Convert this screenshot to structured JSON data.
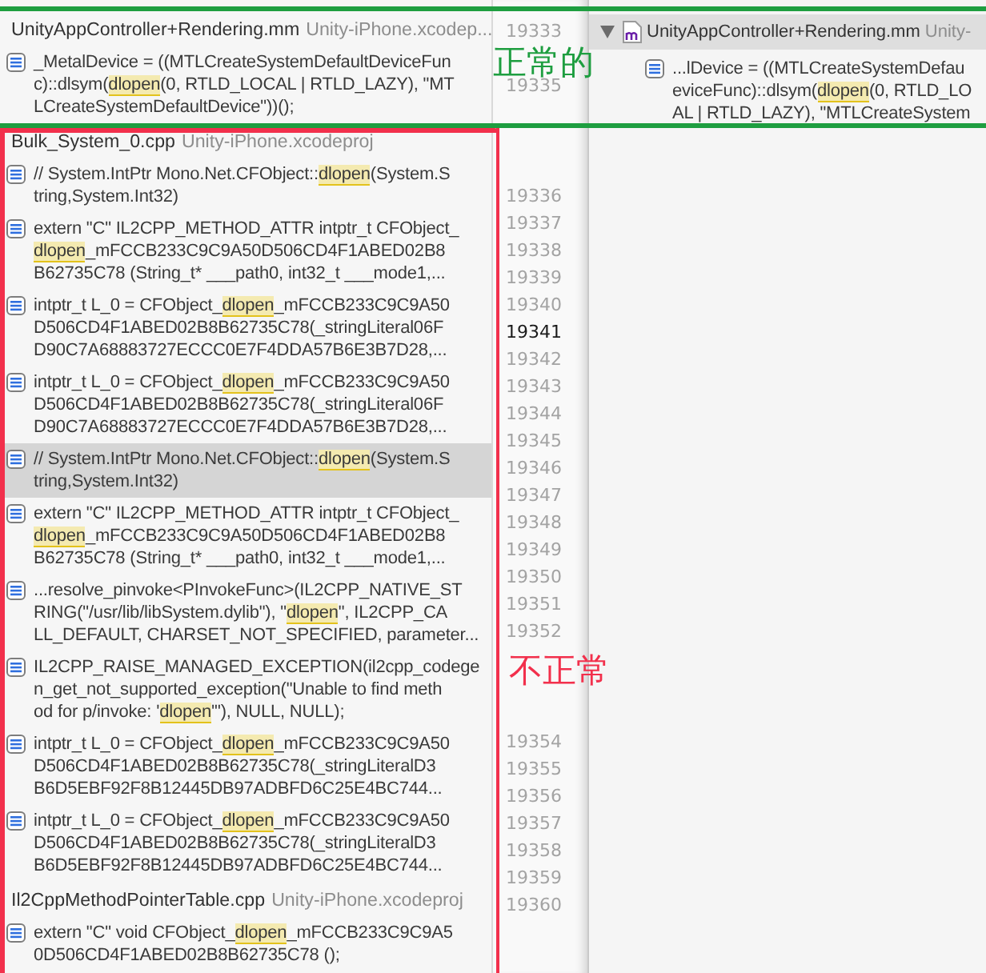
{
  "results_panel": {
    "groups": [
      {
        "file": "UnityAppController+Rendering.mm",
        "project": "Unity-iPhone.xcodep...",
        "results": [
          {
            "selected": false,
            "lines": [
              {
                "pre": "_MetalDevice = ((MTLCreateSystemDefaultDeviceFun"
              },
              {
                "pre": "c)::dlsym(",
                "hit": "dlopen",
                "post": "(0, RTLD_LOCAL | RTLD_LAZY), \"MT"
              },
              {
                "pre": "LCreateSystemDefaultDevice\"))();"
              }
            ]
          }
        ]
      },
      {
        "file": "Bulk_System_0.cpp",
        "project": "Unity-iPhone.xcodeproj",
        "results": [
          {
            "selected": false,
            "lines": [
              {
                "pre": "// System.IntPtr Mono.Net.CFObject::",
                "hit": "dlopen",
                "post": "(System.S"
              },
              {
                "pre": "tring,System.Int32)"
              }
            ]
          },
          {
            "selected": false,
            "lines": [
              {
                "pre": "extern \"C\" IL2CPP_METHOD_ATTR intptr_t CFObject_"
              },
              {
                "hit": "dlopen",
                "post": "_mFCCB233C9C9A50D506CD4F1ABED02B8"
              },
              {
                "pre": "B62735C78 (String_t* ___path0, int32_t ___mode1,..."
              }
            ]
          },
          {
            "selected": false,
            "lines": [
              {
                "pre": "intptr_t L_0 = CFObject_",
                "hit": "dlopen",
                "post": "_mFCCB233C9C9A50"
              },
              {
                "pre": "D506CD4F1ABED02B8B62735C78(_stringLiteral06F"
              },
              {
                "pre": "D90C7A68883727ECCC0E7F4DDA57B6E3B7D28,..."
              }
            ]
          },
          {
            "selected": false,
            "lines": [
              {
                "pre": "intptr_t L_0 = CFObject_",
                "hit": "dlopen",
                "post": "_mFCCB233C9C9A50"
              },
              {
                "pre": "D506CD4F1ABED02B8B62735C78(_stringLiteral06F"
              },
              {
                "pre": "D90C7A68883727ECCC0E7F4DDA57B6E3B7D28,..."
              }
            ]
          },
          {
            "selected": true,
            "lines": [
              {
                "pre": "// System.IntPtr Mono.Net.CFObject::",
                "hit": "dlopen",
                "post": "(System.S"
              },
              {
                "pre": "tring,System.Int32)"
              }
            ]
          },
          {
            "selected": false,
            "lines": [
              {
                "pre": "extern \"C\" IL2CPP_METHOD_ATTR intptr_t CFObject_"
              },
              {
                "hit": "dlopen",
                "post": "_mFCCB233C9C9A50D506CD4F1ABED02B8"
              },
              {
                "pre": "B62735C78 (String_t* ___path0, int32_t ___mode1,..."
              }
            ]
          },
          {
            "selected": false,
            "lines": [
              {
                "pre": "...resolve_pinvoke<PInvokeFunc>(IL2CPP_NATIVE_ST"
              },
              {
                "pre": "RING(\"/usr/lib/libSystem.dylib\"), \"",
                "hit": "dlopen",
                "post": "\", IL2CPP_CA"
              },
              {
                "pre": "LL_DEFAULT, CHARSET_NOT_SPECIFIED, parameter..."
              }
            ]
          },
          {
            "selected": false,
            "lines": [
              {
                "pre": "IL2CPP_RAISE_MANAGED_EXCEPTION(il2cpp_codege"
              },
              {
                "pre": "n_get_not_supported_exception(\"Unable to find meth"
              },
              {
                "pre": "od for p/invoke: '",
                "hit": "dlopen",
                "post": "'\"), NULL, NULL);"
              }
            ]
          },
          {
            "selected": false,
            "lines": [
              {
                "pre": "intptr_t L_0 = CFObject_",
                "hit": "dlopen",
                "post": "_mFCCB233C9C9A50"
              },
              {
                "pre": "D506CD4F1ABED02B8B62735C78(_stringLiteralD3"
              },
              {
                "pre": "B6D5EBF92F8B12445DB97ADBFD6C25E4BC744..."
              }
            ]
          },
          {
            "selected": false,
            "lines": [
              {
                "pre": "intptr_t L_0 = CFObject_",
                "hit": "dlopen",
                "post": "_mFCCB233C9C9A50"
              },
              {
                "pre": "D506CD4F1ABED02B8B62735C78(_stringLiteralD3"
              },
              {
                "pre": "B6D5EBF92F8B12445DB97ADBFD6C25E4BC744..."
              }
            ]
          }
        ]
      },
      {
        "file": "Il2CppMethodPointerTable.cpp",
        "project": "Unity-iPhone.xcodeproj",
        "results": [
          {
            "selected": false,
            "lines": [
              {
                "pre": "extern \"C\" void CFObject_",
                "hit": "dlopen",
                "post": "_mFCCB233C9C9A5"
              },
              {
                "pre": "0D506CD4F1ABED02B8B62735C78 ();"
              }
            ]
          }
        ]
      }
    ]
  },
  "gutter": {
    "top": [
      [
        {
          "n": "19333",
          "current": false
        }
      ],
      [
        {
          "n": "19335",
          "current": false
        }
      ]
    ],
    "bottom": [
      [
        {
          "n": "19336",
          "current": false
        },
        {
          "n": "19337",
          "current": false
        },
        {
          "n": "19338",
          "current": false
        },
        {
          "n": "19339",
          "current": false
        },
        {
          "n": "19340",
          "current": false
        },
        {
          "n": "19341",
          "current": true
        },
        {
          "n": "19342",
          "current": false
        },
        {
          "n": "19343",
          "current": false
        },
        {
          "n": "19344",
          "current": false
        },
        {
          "n": "19345",
          "current": false
        },
        {
          "n": "19346",
          "current": false
        },
        {
          "n": "19347",
          "current": false
        },
        {
          "n": "19348",
          "current": false
        },
        {
          "n": "19349",
          "current": false
        },
        {
          "n": "19350",
          "current": false
        },
        {
          "n": "19351",
          "current": false
        },
        {
          "n": "19352",
          "current": false
        }
      ],
      [
        {
          "n": "19354",
          "current": false
        },
        {
          "n": "19355",
          "current": false
        },
        {
          "n": "19356",
          "current": false
        },
        {
          "n": "19357",
          "current": false
        },
        {
          "n": "19358",
          "current": false
        },
        {
          "n": "19359",
          "current": false
        },
        {
          "n": "19360",
          "current": false
        }
      ]
    ]
  },
  "detail_panel": {
    "file": "UnityAppController+Rendering.mm",
    "project": "Unity-",
    "expanded": true,
    "lines": [
      {
        "pre": "...lDevice = ((MTLCreateSystemDefau"
      },
      {
        "pre": "eviceFunc)::dlsym(",
        "hit": "dlopen",
        "post": "(0, RTLD_LO"
      },
      {
        "pre": "AL | RTLD_LAZY), \"MTLCreateSystem"
      }
    ]
  },
  "annotations": [
    {
      "kind": "ok",
      "color": "#1e9e40",
      "label": "正常的"
    },
    {
      "kind": "bad",
      "color": "#f2304c",
      "label": "不正常"
    }
  ]
}
